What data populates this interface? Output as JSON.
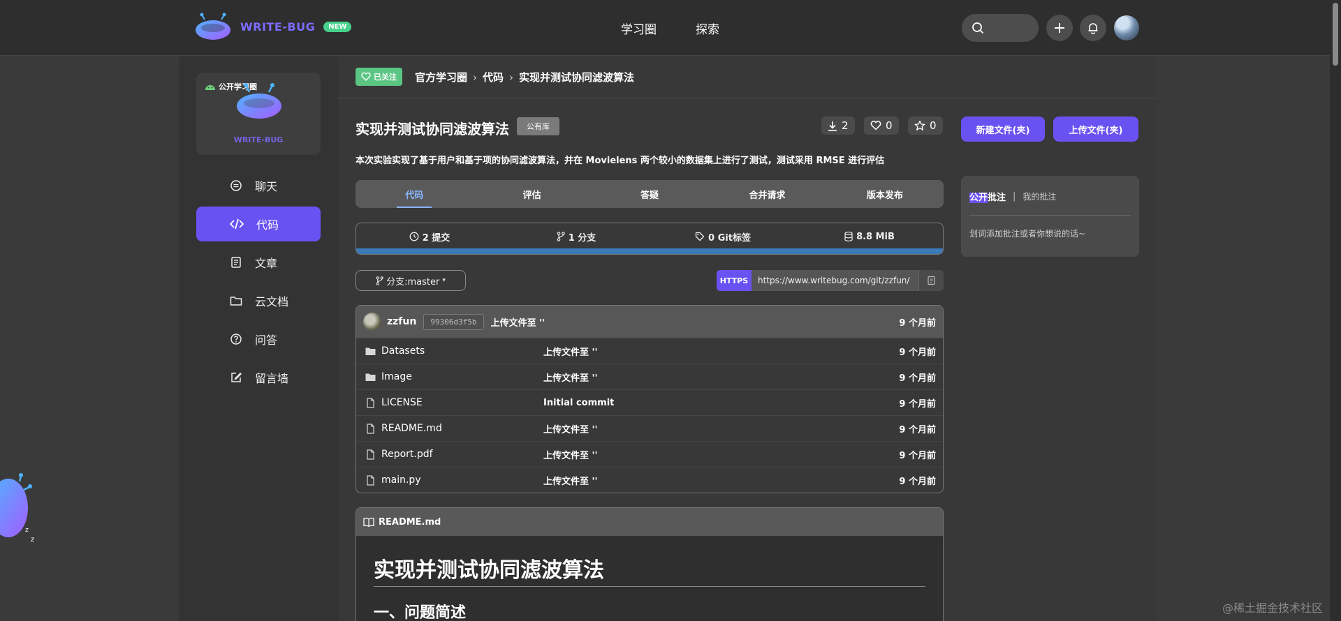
{
  "brand": {
    "name": "WRITE-BUG",
    "badge": "NEW"
  },
  "top_nav": [
    "学习圈",
    "探索"
  ],
  "sidebar": {
    "card": {
      "label": "公开学习圈",
      "logo_text": "WRITE-BUG"
    },
    "items": [
      {
        "label": "聊天",
        "icon": "chat-icon"
      },
      {
        "label": "代码",
        "icon": "code-icon",
        "active": true
      },
      {
        "label": "文章",
        "icon": "article-icon"
      },
      {
        "label": "云文档",
        "icon": "folder-icon"
      },
      {
        "label": "问答",
        "icon": "question-icon"
      },
      {
        "label": "留言墙",
        "icon": "edit-icon"
      }
    ]
  },
  "breadcrumb": {
    "follow": "已关注",
    "items": [
      "官方学习圈",
      "代码",
      "实现并测试协同滤波算法"
    ]
  },
  "repo": {
    "title": "实现并测试协同滤波算法",
    "badge": "公有库",
    "downloads": "2",
    "likes": "0",
    "stars": "0",
    "description": "本次实验实现了基于用户和基于项的协同滤波算法，并在 Movielens 两个较小的数据集上进行了测试，测试采用 RMSE 进行评估"
  },
  "tabs": [
    "代码",
    "评估",
    "答疑",
    "合并请求",
    "版本发布"
  ],
  "stats": {
    "commits": "2 提交",
    "branches": "1 分支",
    "tags": "0 Git标签",
    "size": "8.8 MiB"
  },
  "branch": "分支:master",
  "clone": {
    "protocol": "HTTPS",
    "url": "https://www.writebug.com/git/zzfun/"
  },
  "latest_commit": {
    "user": "zzfun",
    "hash": "99306d3f5b",
    "message": "上传文件至 ''",
    "time": "9 个月前"
  },
  "files": [
    {
      "name": "Datasets",
      "type": "folder",
      "message": "上传文件至 ''",
      "time": "9 个月前"
    },
    {
      "name": "Image",
      "type": "folder",
      "message": "上传文件至 ''",
      "time": "9 个月前"
    },
    {
      "name": "LICENSE",
      "type": "file",
      "message": "Initial commit",
      "time": "9 个月前"
    },
    {
      "name": "README.md",
      "type": "file",
      "message": "上传文件至 ''",
      "time": "9 个月前"
    },
    {
      "name": "Report.pdf",
      "type": "file",
      "message": "上传文件至 ''",
      "time": "9 个月前"
    },
    {
      "name": "main.py",
      "type": "file",
      "message": "上传文件至 ''",
      "time": "9 个月前"
    }
  ],
  "readme": {
    "filename": "README.md",
    "h1": "实现并测试协同滤波算法",
    "h2": "一、问题简述"
  },
  "actions": {
    "new": "新建文件(夹)",
    "upload": "上传文件(夹)"
  },
  "notes": {
    "tab_public_highlight": "公开",
    "tab_public_rest": "批注",
    "separator": "|",
    "tab_mine": "我的批注",
    "hint": "划词添加批注或者你想说的话~"
  },
  "watermark": "@稀土掘金技术社区",
  "colors": {
    "accent": "#6a52f2",
    "follow_green": "#5bc683",
    "lang_bar": "#3a7ab8",
    "tab_active": "#8ab4ff"
  }
}
